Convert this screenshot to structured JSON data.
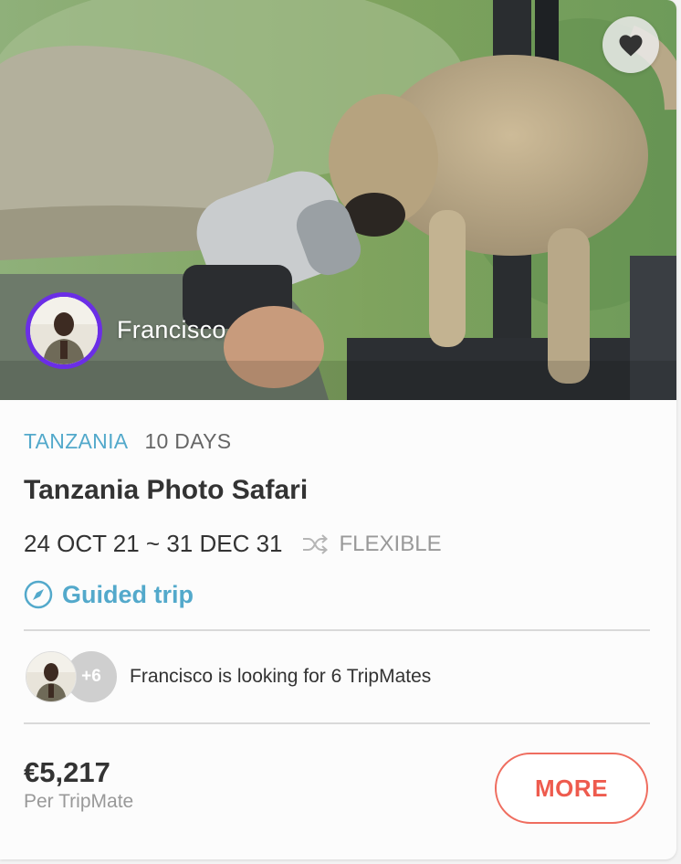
{
  "card": {
    "favorite_icon": "heart-icon",
    "host_name": "Francisco",
    "country": "TANZANIA",
    "duration": "10 DAYS",
    "title": "Tanzania Photo Safari",
    "dates": "24 OCT 21 ~ 31 DEC 31",
    "flexible_icon": "shuffle-icon",
    "flexible_label": "FLEXIBLE",
    "trip_type_icon": "compass-icon",
    "trip_type": "Guided trip",
    "mates_count_badge": "+6",
    "mates_text": "Francisco is looking for 6 TripMates",
    "price": "€5,217",
    "price_unit": "Per TripMate",
    "more_button": "MORE"
  },
  "colors": {
    "accent_blue": "#53a9cb",
    "button_red": "#ee5b4e",
    "avatar_ring": "#6b2ee6"
  }
}
